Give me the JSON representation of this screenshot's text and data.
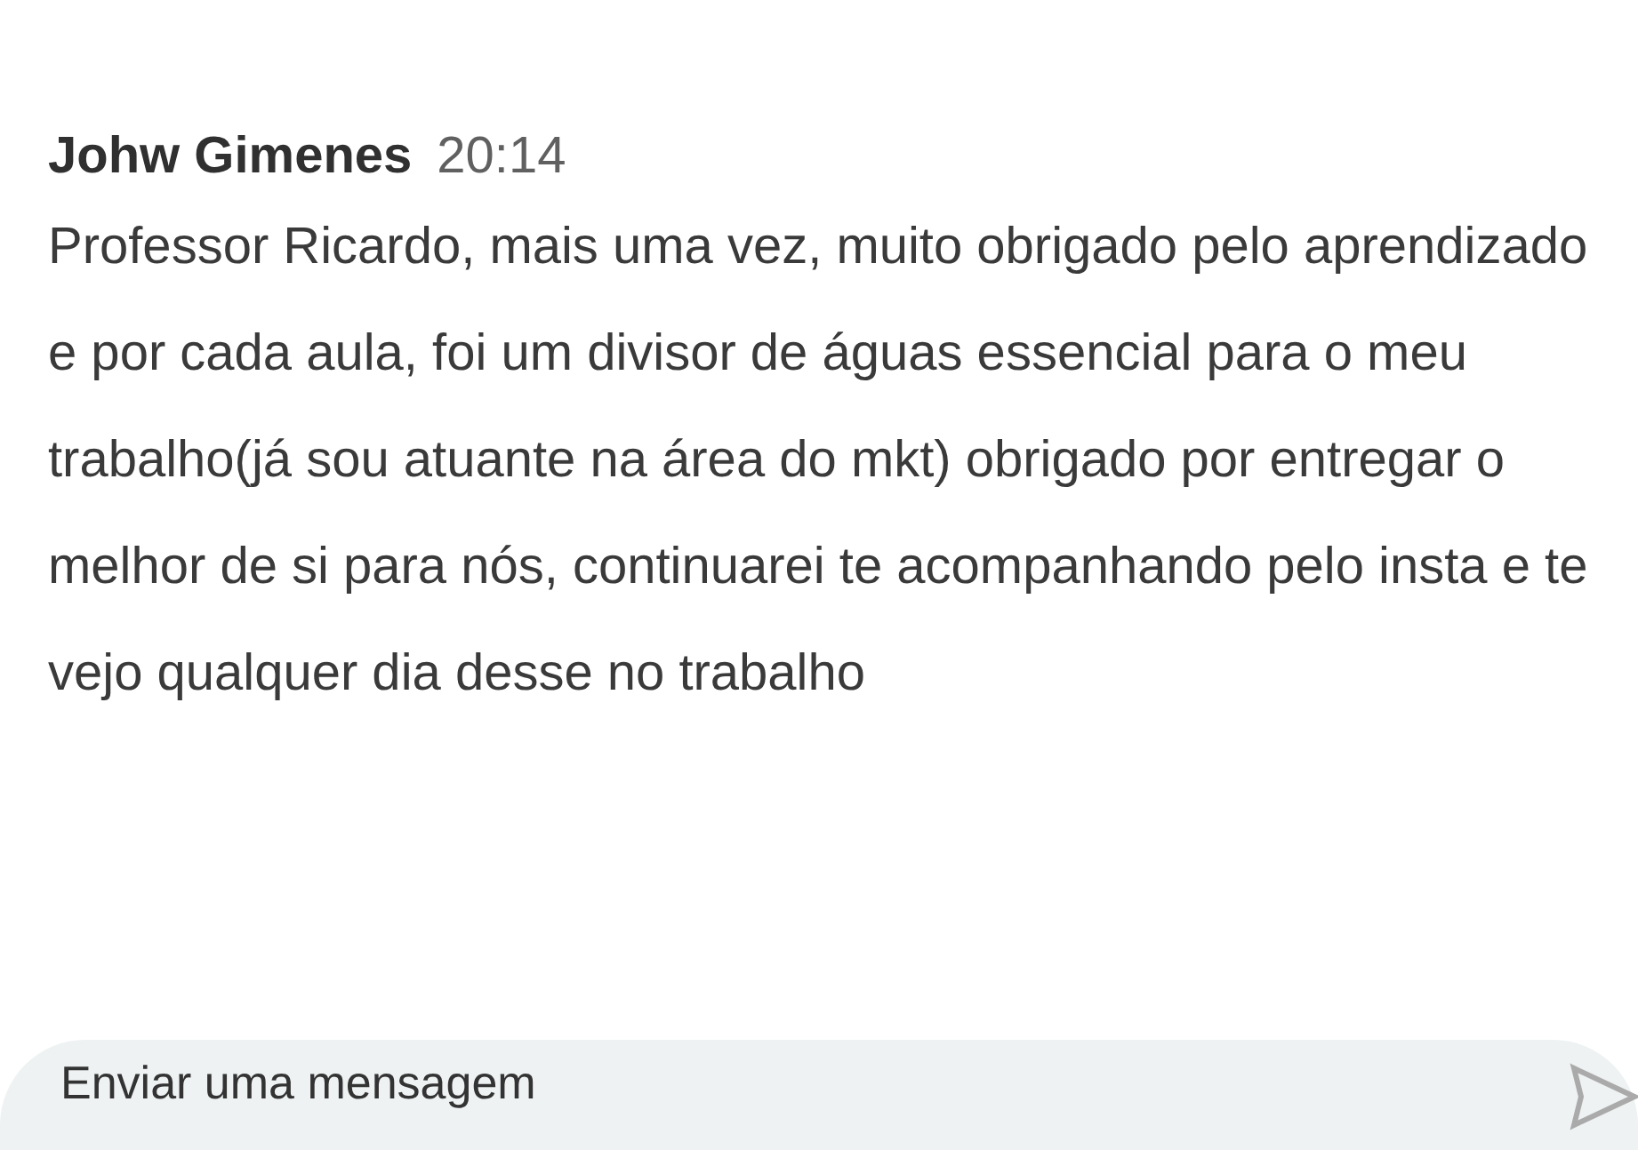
{
  "message": {
    "author": "Johw Gimenes",
    "time": "20:14",
    "text": "Professor Ricardo, mais uma vez, muito obrigado pelo aprendizado e por cada aula, foi um divisor de águas essencial para o meu trabalho(já sou atuante na área do mkt) obrigado por entregar o melhor de si para nós, continuarei te acompanhando pelo insta e te vejo qualquer dia desse no trabalho"
  },
  "composer": {
    "placeholder": "Enviar uma mensagem"
  }
}
